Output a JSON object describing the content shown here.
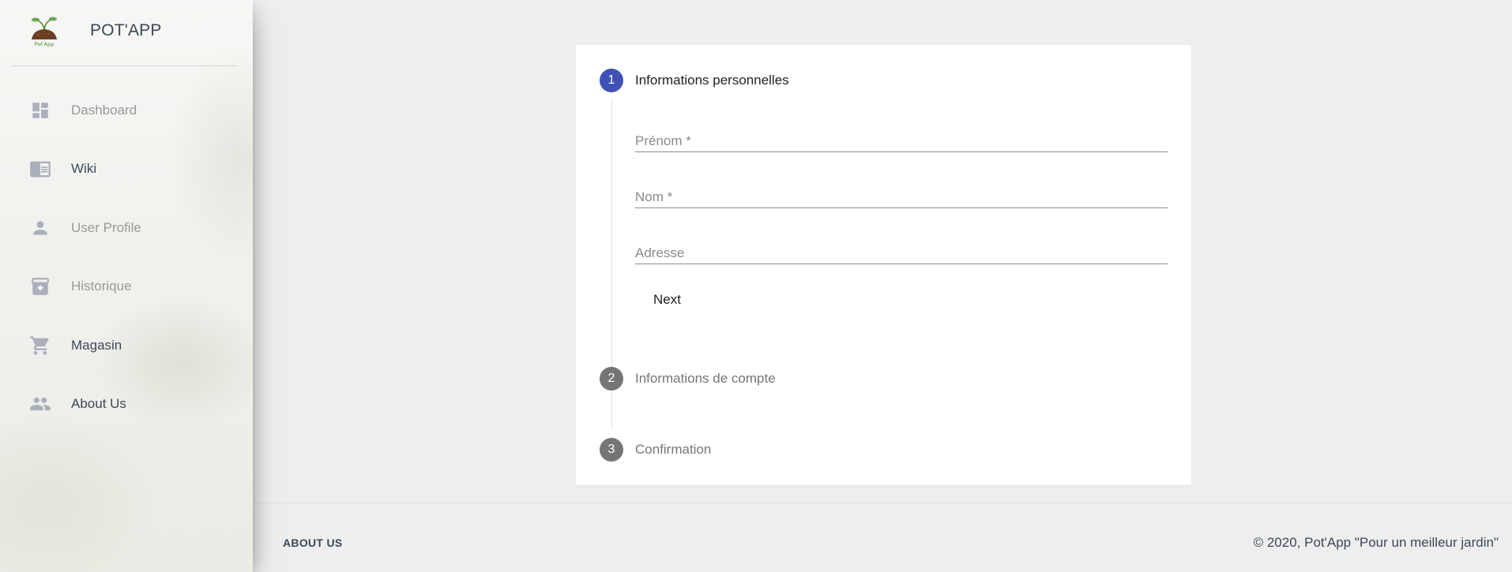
{
  "app": {
    "title": "POT'APP",
    "logo_caption": "Pot'App"
  },
  "sidebar": {
    "items": [
      {
        "label": "Dashboard",
        "icon": "dashboard-icon"
      },
      {
        "label": "Wiki",
        "icon": "chrome-reader-icon"
      },
      {
        "label": "User Profile",
        "icon": "person-icon"
      },
      {
        "label": "Historique",
        "icon": "archive-icon"
      },
      {
        "label": "Magasin",
        "icon": "shopping-cart-icon"
      },
      {
        "label": "About Us",
        "icon": "people-icon"
      }
    ]
  },
  "stepper": {
    "steps": [
      {
        "number": "1",
        "label": "Informations personnelles",
        "state": "active"
      },
      {
        "number": "2",
        "label": "Informations de compte",
        "state": "inactive"
      },
      {
        "number": "3",
        "label": "Confirmation",
        "state": "inactive"
      }
    ],
    "fields": [
      {
        "placeholder": "Prénom *",
        "value": ""
      },
      {
        "placeholder": "Nom *",
        "value": ""
      },
      {
        "placeholder": "Adresse",
        "value": ""
      }
    ],
    "next_label": "Next"
  },
  "footer": {
    "link_label": "ABOUT US",
    "copyright": "© 2020, Pot'App \"Pour un meilleur jardin\""
  },
  "colors": {
    "accent": "#3f51b5",
    "inactive_step": "#757575",
    "icon": "#a9afbb"
  }
}
